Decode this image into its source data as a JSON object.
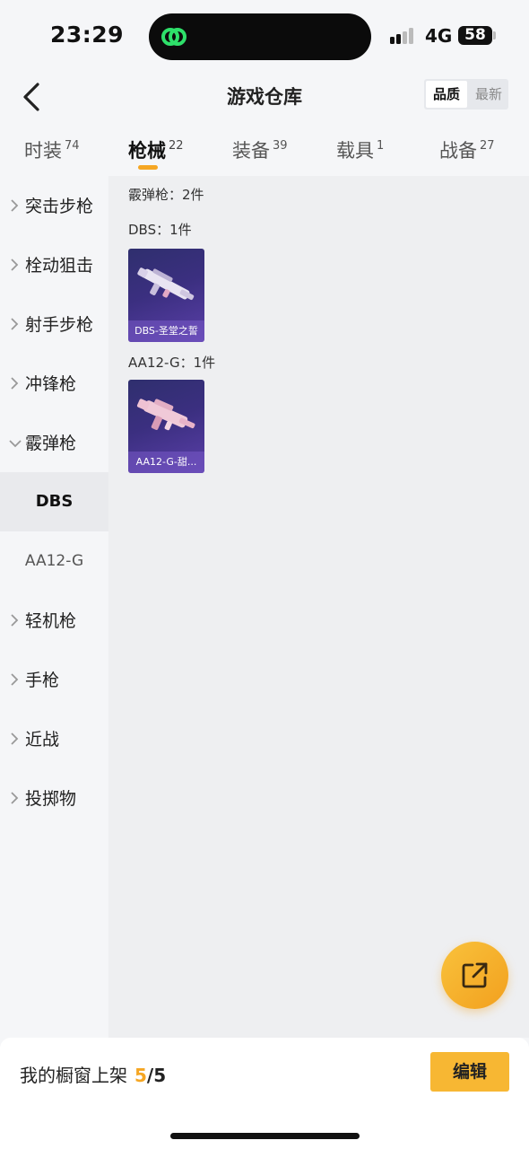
{
  "status_bar": {
    "time": "23:29",
    "network": "4G",
    "battery": "58"
  },
  "header": {
    "title": "游戏仓库",
    "sort_options": [
      "品质",
      "最新"
    ],
    "sort_selected": "品质"
  },
  "tabs": [
    {
      "label": "时装",
      "count": "74"
    },
    {
      "label": "枪械",
      "count": "22"
    },
    {
      "label": "装备",
      "count": "39"
    },
    {
      "label": "载具",
      "count": "1"
    },
    {
      "label": "战备",
      "count": "27"
    }
  ],
  "active_tab": "枪械",
  "sidebar": {
    "items": [
      "突击步枪",
      "栓动狙击",
      "射手步枪",
      "冲锋枪",
      "霰弹枪"
    ],
    "expanded_item": "霰弹枪",
    "sub_items": [
      "DBS",
      "AA12-G"
    ],
    "selected_sub_item": "DBS",
    "items_after": [
      "轻机枪",
      "手枪",
      "近战",
      "投掷物"
    ]
  },
  "content": {
    "category_summary": "霰弹枪：2件",
    "groups": [
      {
        "title": "DBS：1件",
        "item_label": "DBS-圣堂之誓"
      },
      {
        "title": "AA12-G：1件",
        "item_label": "AA12-G-甜..."
      }
    ]
  },
  "bottom_bar": {
    "shelf_label": "我的橱窗上架",
    "shelf_count": "5",
    "shelf_total": "/5",
    "edit_label": "编辑"
  },
  "colors": {
    "accent": "#f5a623",
    "card_bg": "#3b2f80"
  }
}
